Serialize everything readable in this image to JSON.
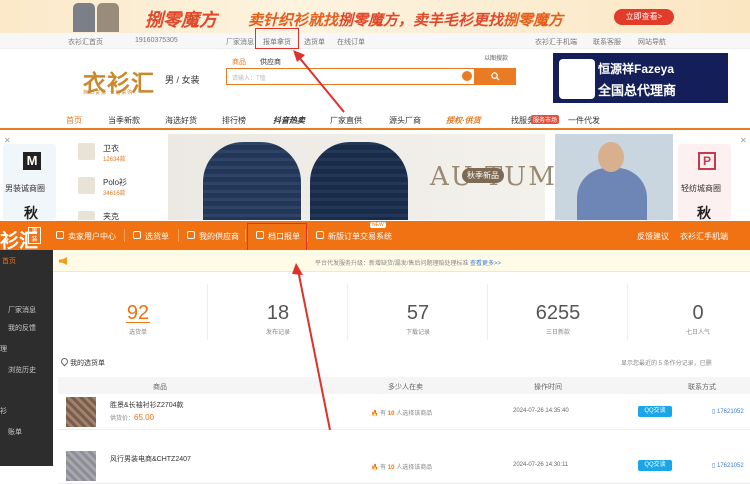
{
  "banner": {
    "text1": "捌零魔方",
    "text2": "卖针织衫就找",
    "text3": "捌零魔方，卖羊毛衫更找",
    "text4": "捌零魔方",
    "cta": "立即查看>"
  },
  "topbar": {
    "brand": "衣衫汇首页",
    "user": "19160375305",
    "items": [
      "厂家消息",
      "报单拿货",
      "选货单",
      "在线订单"
    ],
    "right": [
      "衣衫汇手机端",
      "联系客服",
      "网站导航"
    ]
  },
  "header": {
    "logo": "衣衫汇",
    "logo_sub": "档口货源 一站采购",
    "gender": "男 / 女装",
    "search_tabs": [
      "商品",
      "供应商"
    ],
    "search_placeholder": "请输入：T恤",
    "image_search": "以图搜款",
    "ad_title": "恒源祥Fazeya",
    "ad_sub": "全国总代理商"
  },
  "nav": {
    "items": [
      "首页",
      "当季新款",
      "海选好货",
      "排行榜",
      "抖音热卖",
      "厂家直供",
      "源头厂商",
      "授权·供货",
      "找服务商",
      "一件代发"
    ],
    "badge": "服务市场"
  },
  "hero": {
    "left_card": {
      "icon": "M",
      "label": "男装诚商圈",
      "season": "秋"
    },
    "categories": [
      {
        "name": "卫衣",
        "count": "12634款"
      },
      {
        "name": "Polo衫",
        "count": "34616款"
      },
      {
        "name": "夹克",
        "count": ""
      }
    ],
    "autumn_tag": "秋季新品",
    "autumn_text": "AU TUMN",
    "right_card": {
      "label": "轻纺城商圈",
      "season": "秋"
    }
  },
  "center": {
    "logo": "衫汇",
    "logo_badge": "男装",
    "nav": [
      "卖家用户中心",
      "选货单",
      "我的供应商",
      "档口报单",
      "新版订单交易系统"
    ],
    "new_badge": "NEW",
    "right": [
      "反馈建议",
      "衣衫汇手机端"
    ],
    "side": [
      "首页",
      "厂家消息",
      "我的反馈",
      "理",
      "浏览历史",
      "衫",
      "账单"
    ],
    "notice": "平台代发服务升级：新增缺货/漏发/售后问题理赔处理标准",
    "notice_more": "查看更多>>",
    "stats": [
      {
        "num": "92",
        "label": "选货单"
      },
      {
        "num": "18",
        "label": "发布记录"
      },
      {
        "num": "57",
        "label": "下载记录"
      },
      {
        "num": "6255",
        "label": "三日新款"
      },
      {
        "num": "0",
        "label": "七日人气"
      }
    ],
    "list_title": "我的选货单",
    "list_hint": "显示您最近的 5 条作分记录，已删",
    "columns": [
      "商品",
      "多少人在卖",
      "操作时间",
      "联系方式"
    ],
    "rows": [
      {
        "name": "胜景&长袖衬衫Z2704款",
        "price_label": "供货价：",
        "price": "65.00",
        "count": "10",
        "sellers_suffix": "人选择该商品",
        "time": "2024-07-26 14:35:40",
        "qq": "QQ交谈",
        "phone": "17621052"
      },
      {
        "name": "风行男装电商&CHTZ2407",
        "price_label": "",
        "price": "",
        "count": "10",
        "sellers_suffix": "人选择该商品",
        "time": "2024-07-26 14:30:11",
        "qq": "QQ交谈",
        "phone": "17621052"
      }
    ],
    "sellers_prefix": "有"
  },
  "colors": {
    "orange": "#f07213",
    "accent": "#e87b24",
    "annotation": "#e0302a"
  }
}
